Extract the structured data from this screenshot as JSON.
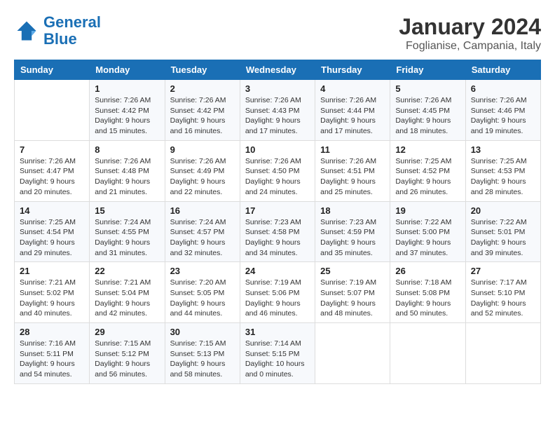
{
  "logo": {
    "text_general": "General",
    "text_blue": "Blue"
  },
  "title": "January 2024",
  "subtitle": "Foglianise, Campania, Italy",
  "headers": [
    "Sunday",
    "Monday",
    "Tuesday",
    "Wednesday",
    "Thursday",
    "Friday",
    "Saturday"
  ],
  "weeks": [
    [
      {
        "day": "",
        "sunrise": "",
        "sunset": "",
        "daylight": ""
      },
      {
        "day": "1",
        "sunrise": "Sunrise: 7:26 AM",
        "sunset": "Sunset: 4:42 PM",
        "daylight": "Daylight: 9 hours and 15 minutes."
      },
      {
        "day": "2",
        "sunrise": "Sunrise: 7:26 AM",
        "sunset": "Sunset: 4:42 PM",
        "daylight": "Daylight: 9 hours and 16 minutes."
      },
      {
        "day": "3",
        "sunrise": "Sunrise: 7:26 AM",
        "sunset": "Sunset: 4:43 PM",
        "daylight": "Daylight: 9 hours and 17 minutes."
      },
      {
        "day": "4",
        "sunrise": "Sunrise: 7:26 AM",
        "sunset": "Sunset: 4:44 PM",
        "daylight": "Daylight: 9 hours and 17 minutes."
      },
      {
        "day": "5",
        "sunrise": "Sunrise: 7:26 AM",
        "sunset": "Sunset: 4:45 PM",
        "daylight": "Daylight: 9 hours and 18 minutes."
      },
      {
        "day": "6",
        "sunrise": "Sunrise: 7:26 AM",
        "sunset": "Sunset: 4:46 PM",
        "daylight": "Daylight: 9 hours and 19 minutes."
      }
    ],
    [
      {
        "day": "7",
        "sunrise": "Sunrise: 7:26 AM",
        "sunset": "Sunset: 4:47 PM",
        "daylight": "Daylight: 9 hours and 20 minutes."
      },
      {
        "day": "8",
        "sunrise": "Sunrise: 7:26 AM",
        "sunset": "Sunset: 4:48 PM",
        "daylight": "Daylight: 9 hours and 21 minutes."
      },
      {
        "day": "9",
        "sunrise": "Sunrise: 7:26 AM",
        "sunset": "Sunset: 4:49 PM",
        "daylight": "Daylight: 9 hours and 22 minutes."
      },
      {
        "day": "10",
        "sunrise": "Sunrise: 7:26 AM",
        "sunset": "Sunset: 4:50 PM",
        "daylight": "Daylight: 9 hours and 24 minutes."
      },
      {
        "day": "11",
        "sunrise": "Sunrise: 7:26 AM",
        "sunset": "Sunset: 4:51 PM",
        "daylight": "Daylight: 9 hours and 25 minutes."
      },
      {
        "day": "12",
        "sunrise": "Sunrise: 7:25 AM",
        "sunset": "Sunset: 4:52 PM",
        "daylight": "Daylight: 9 hours and 26 minutes."
      },
      {
        "day": "13",
        "sunrise": "Sunrise: 7:25 AM",
        "sunset": "Sunset: 4:53 PM",
        "daylight": "Daylight: 9 hours and 28 minutes."
      }
    ],
    [
      {
        "day": "14",
        "sunrise": "Sunrise: 7:25 AM",
        "sunset": "Sunset: 4:54 PM",
        "daylight": "Daylight: 9 hours and 29 minutes."
      },
      {
        "day": "15",
        "sunrise": "Sunrise: 7:24 AM",
        "sunset": "Sunset: 4:55 PM",
        "daylight": "Daylight: 9 hours and 31 minutes."
      },
      {
        "day": "16",
        "sunrise": "Sunrise: 7:24 AM",
        "sunset": "Sunset: 4:57 PM",
        "daylight": "Daylight: 9 hours and 32 minutes."
      },
      {
        "day": "17",
        "sunrise": "Sunrise: 7:23 AM",
        "sunset": "Sunset: 4:58 PM",
        "daylight": "Daylight: 9 hours and 34 minutes."
      },
      {
        "day": "18",
        "sunrise": "Sunrise: 7:23 AM",
        "sunset": "Sunset: 4:59 PM",
        "daylight": "Daylight: 9 hours and 35 minutes."
      },
      {
        "day": "19",
        "sunrise": "Sunrise: 7:22 AM",
        "sunset": "Sunset: 5:00 PM",
        "daylight": "Daylight: 9 hours and 37 minutes."
      },
      {
        "day": "20",
        "sunrise": "Sunrise: 7:22 AM",
        "sunset": "Sunset: 5:01 PM",
        "daylight": "Daylight: 9 hours and 39 minutes."
      }
    ],
    [
      {
        "day": "21",
        "sunrise": "Sunrise: 7:21 AM",
        "sunset": "Sunset: 5:02 PM",
        "daylight": "Daylight: 9 hours and 40 minutes."
      },
      {
        "day": "22",
        "sunrise": "Sunrise: 7:21 AM",
        "sunset": "Sunset: 5:04 PM",
        "daylight": "Daylight: 9 hours and 42 minutes."
      },
      {
        "day": "23",
        "sunrise": "Sunrise: 7:20 AM",
        "sunset": "Sunset: 5:05 PM",
        "daylight": "Daylight: 9 hours and 44 minutes."
      },
      {
        "day": "24",
        "sunrise": "Sunrise: 7:19 AM",
        "sunset": "Sunset: 5:06 PM",
        "daylight": "Daylight: 9 hours and 46 minutes."
      },
      {
        "day": "25",
        "sunrise": "Sunrise: 7:19 AM",
        "sunset": "Sunset: 5:07 PM",
        "daylight": "Daylight: 9 hours and 48 minutes."
      },
      {
        "day": "26",
        "sunrise": "Sunrise: 7:18 AM",
        "sunset": "Sunset: 5:08 PM",
        "daylight": "Daylight: 9 hours and 50 minutes."
      },
      {
        "day": "27",
        "sunrise": "Sunrise: 7:17 AM",
        "sunset": "Sunset: 5:10 PM",
        "daylight": "Daylight: 9 hours and 52 minutes."
      }
    ],
    [
      {
        "day": "28",
        "sunrise": "Sunrise: 7:16 AM",
        "sunset": "Sunset: 5:11 PM",
        "daylight": "Daylight: 9 hours and 54 minutes."
      },
      {
        "day": "29",
        "sunrise": "Sunrise: 7:15 AM",
        "sunset": "Sunset: 5:12 PM",
        "daylight": "Daylight: 9 hours and 56 minutes."
      },
      {
        "day": "30",
        "sunrise": "Sunrise: 7:15 AM",
        "sunset": "Sunset: 5:13 PM",
        "daylight": "Daylight: 9 hours and 58 minutes."
      },
      {
        "day": "31",
        "sunrise": "Sunrise: 7:14 AM",
        "sunset": "Sunset: 5:15 PM",
        "daylight": "Daylight: 10 hours and 0 minutes."
      },
      {
        "day": "",
        "sunrise": "",
        "sunset": "",
        "daylight": ""
      },
      {
        "day": "",
        "sunrise": "",
        "sunset": "",
        "daylight": ""
      },
      {
        "day": "",
        "sunrise": "",
        "sunset": "",
        "daylight": ""
      }
    ]
  ]
}
